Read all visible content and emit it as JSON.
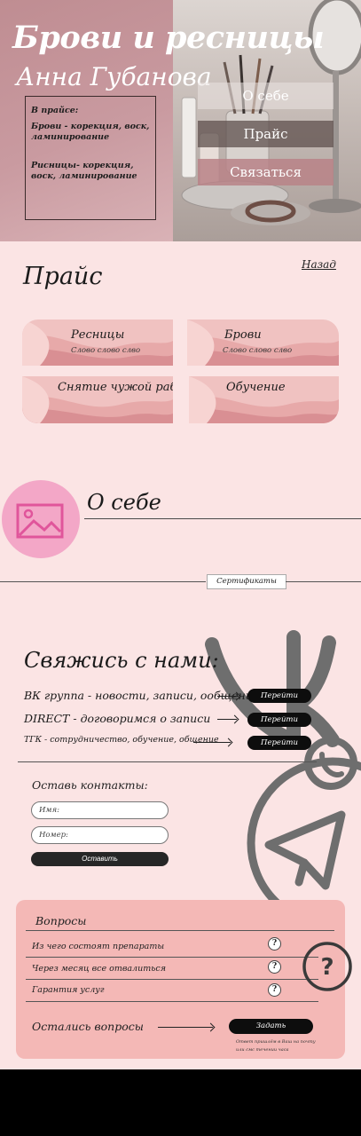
{
  "hero": {
    "title": "Брови и ресницы",
    "subtitle": "Анна Губанова",
    "info_heading": "В прайсе:",
    "info_brows": "Брови - корекция, воск, ламинирование",
    "info_lashes": "Рисницы- корекция, воск, ламинирование",
    "menu": {
      "about": "О себе",
      "price": "Прайс",
      "contact": "Связаться"
    }
  },
  "price": {
    "title": "Прайс",
    "back": "Назад",
    "cards": [
      {
        "title": "Ресницы",
        "subtitle": "Слово слово слво"
      },
      {
        "title": "Брови",
        "subtitle": "Слово слово слво"
      },
      {
        "title": "Снятие чужой работы",
        "subtitle": ""
      },
      {
        "title": "Обучение",
        "subtitle": ""
      }
    ]
  },
  "about": {
    "title": "О себе",
    "certificates": "Сертификаты"
  },
  "contact": {
    "title": "Свяжись с нами:",
    "rows": [
      {
        "label": "ВК группа - новости, записи, ообщение",
        "button": "Перейти"
      },
      {
        "label": "DIRECT -  договоримся о записи",
        "button": "Перейти"
      },
      {
        "label": "ТГК - сотрудничество, обучение, общение",
        "button": "Перейти"
      }
    ],
    "form": {
      "title": "Оставь контакты:",
      "name_placeholder": "Имя:",
      "phone_placeholder": "Номер:",
      "submit": "Оставить"
    }
  },
  "faq": {
    "title": "Вопросы",
    "questions": [
      "Из чего состоят препараты",
      "Через месяц все отвалиться",
      "Гарантия услуг"
    ],
    "qmark": "?",
    "left_title": "Остались вопросы",
    "ask_button": "Задать",
    "note": "Ответ пришлём в Ваш на почту или смс  течении часа"
  },
  "colors": {
    "page_bg": "#fbe4e4",
    "hero_pink": "#c99aa0",
    "accent_pink": "#f3a7c7",
    "faq_bg": "#f4b8b6",
    "button_dark": "#0d0d0d"
  },
  "icons": [
    "image-placeholder-icon",
    "vk-logo-icon",
    "whatsapp-icon",
    "telegram-icon",
    "question-icon",
    "arrow-right-icon"
  ]
}
